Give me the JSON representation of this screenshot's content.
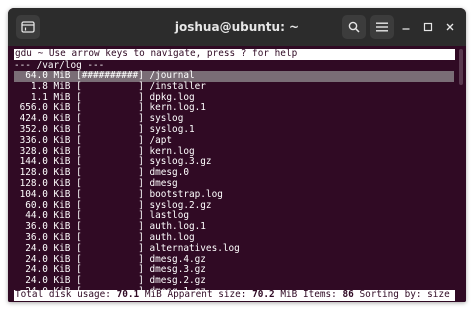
{
  "window": {
    "title": "joshua@ubuntu: ~"
  },
  "terminal": {
    "help_text": "gdu ~ Use arrow keys to navigate, press ? for help",
    "current_path": "--- /var/log ---",
    "rows": [
      {
        "size": "64.0",
        "unit": "MiB",
        "bar": "##########",
        "name": "/journal"
      },
      {
        "size": "1.8",
        "unit": "MiB",
        "bar": "          ",
        "name": "/installer"
      },
      {
        "size": "1.1",
        "unit": "MiB",
        "bar": "          ",
        "name": "dpkg.log"
      },
      {
        "size": "656.0",
        "unit": "KiB",
        "bar": "          ",
        "name": "kern.log.1"
      },
      {
        "size": "424.0",
        "unit": "KiB",
        "bar": "          ",
        "name": "syslog"
      },
      {
        "size": "352.0",
        "unit": "KiB",
        "bar": "          ",
        "name": "syslog.1"
      },
      {
        "size": "336.0",
        "unit": "KiB",
        "bar": "          ",
        "name": "/apt"
      },
      {
        "size": "328.0",
        "unit": "KiB",
        "bar": "          ",
        "name": "kern.log"
      },
      {
        "size": "144.0",
        "unit": "KiB",
        "bar": "          ",
        "name": "syslog.3.gz"
      },
      {
        "size": "128.0",
        "unit": "KiB",
        "bar": "          ",
        "name": "dmesg.0"
      },
      {
        "size": "128.0",
        "unit": "KiB",
        "bar": "          ",
        "name": "dmesg"
      },
      {
        "size": "104.0",
        "unit": "KiB",
        "bar": "          ",
        "name": "bootstrap.log"
      },
      {
        "size": "60.0",
        "unit": "KiB",
        "bar": "          ",
        "name": "syslog.2.gz"
      },
      {
        "size": "44.0",
        "unit": "KiB",
        "bar": "          ",
        "name": "lastlog"
      },
      {
        "size": "36.0",
        "unit": "KiB",
        "bar": "          ",
        "name": "auth.log.1"
      },
      {
        "size": "36.0",
        "unit": "KiB",
        "bar": "          ",
        "name": "auth.log"
      },
      {
        "size": "24.0",
        "unit": "KiB",
        "bar": "          ",
        "name": "alternatives.log"
      },
      {
        "size": "24.0",
        "unit": "KiB",
        "bar": "          ",
        "name": "dmesg.4.gz"
      },
      {
        "size": "24.0",
        "unit": "KiB",
        "bar": "          ",
        "name": "dmesg.3.gz"
      },
      {
        "size": "24.0",
        "unit": "KiB",
        "bar": "          ",
        "name": "dmesg.2.gz"
      },
      {
        "size": "24.0",
        "unit": "KiB",
        "bar": "          ",
        "name": "dmesg.1.gz"
      }
    ],
    "selected_row": 0,
    "status": {
      "total_label": "Total disk usage:",
      "total_value": "70.1",
      "total_unit": "MiB",
      "apparent_label": "Apparent size:",
      "apparent_value": "70.2",
      "apparent_unit": "MiB",
      "items_label": "Items:",
      "items_value": "86",
      "sort_text": "Sorting by: size desc"
    }
  },
  "colors": {
    "terminal_bg": "#300a24",
    "titlebar_bg": "#2c2c2c",
    "selected_row_bg": "#7a6d76"
  },
  "icons": {
    "new_tab": "terminal-tab-icon",
    "search": "search-icon",
    "menu": "hamburger-menu-icon",
    "minimize": "minimize-icon",
    "maximize": "maximize-icon",
    "close": "close-icon"
  }
}
